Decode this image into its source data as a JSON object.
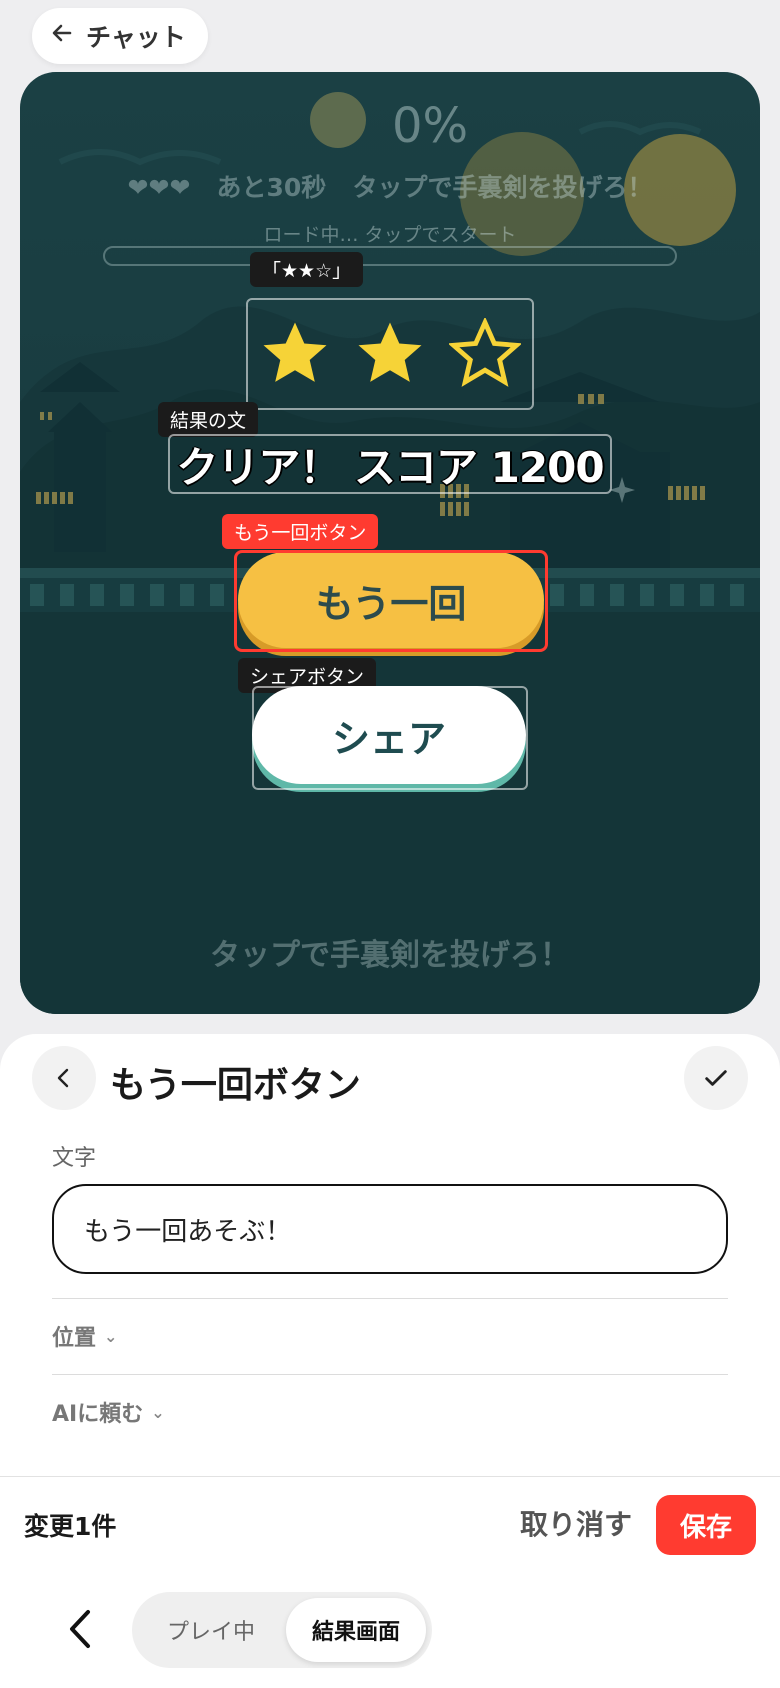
{
  "top_bar": {
    "back_label": "チャット"
  },
  "game": {
    "progress_text": "0%",
    "hud": {
      "lives": "❤❤❤",
      "time_left": "あと30秒",
      "instruction": "タップで手裏剣を投げろ！"
    },
    "loading_text": "ロード中… タップでスタート",
    "stars": {
      "earned": 2,
      "total": 3,
      "tag": "「★★☆」"
    },
    "result_tag": "結果の文",
    "result_text": "クリア！ スコア 1200",
    "retry_tag": "もう一回ボタン",
    "retry_label": "もう一回",
    "share_tag": "シェアボタン",
    "share_label": "シェア",
    "bottom_hint": "タップで手裏剣を投げろ！"
  },
  "editor": {
    "title": "もう一回ボタン",
    "text_field_label": "文字",
    "text_field_value": "もう一回あそぶ！",
    "sections": [
      "位置",
      "AIに頼む"
    ]
  },
  "changes_bar": {
    "count_label": "変更1件",
    "undo_label": "取り消す",
    "save_label": "保存"
  },
  "bottom_nav": {
    "tabs": [
      "プレイ中",
      "結果画面"
    ],
    "active_tab": "結果画面"
  },
  "colors": {
    "accent_red": "#ff3b30",
    "game_bg": "#1d4347",
    "retry_yellow": "#f6c043"
  }
}
